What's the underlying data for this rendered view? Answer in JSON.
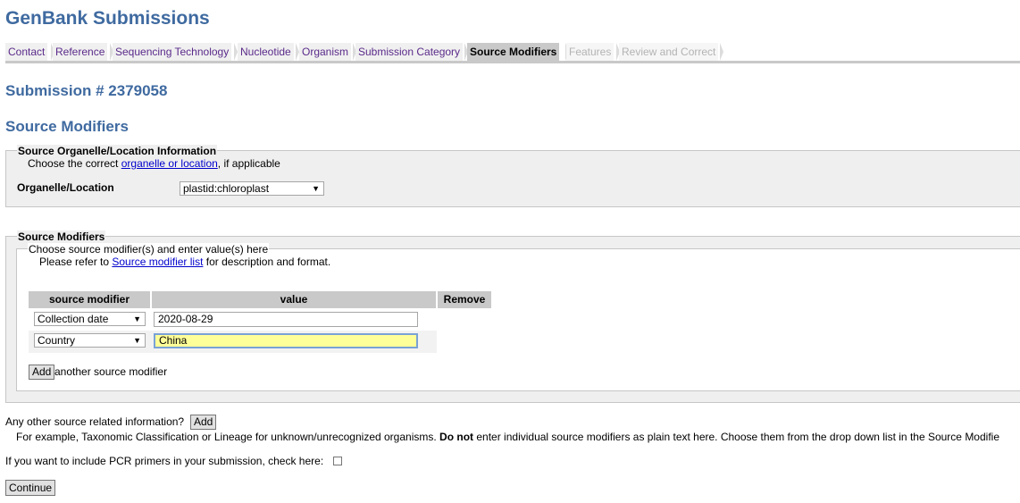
{
  "app_title": "GenBank Submissions",
  "tabs": [
    {
      "label": "Contact",
      "state": "normal"
    },
    {
      "label": "Reference",
      "state": "normal"
    },
    {
      "label": "Sequencing Technology",
      "state": "normal"
    },
    {
      "label": "Nucleotide",
      "state": "normal"
    },
    {
      "label": "Organism",
      "state": "normal"
    },
    {
      "label": "Submission Category",
      "state": "normal"
    },
    {
      "label": "Source Modifiers",
      "state": "active"
    },
    {
      "label": "Features",
      "state": "disabled"
    },
    {
      "label": "Review and Correct",
      "state": "disabled"
    }
  ],
  "submission_title": "Submission # 2379058",
  "section_title": "Source Modifiers",
  "organelle_box": {
    "legend": "Source Organelle/Location Information",
    "hint_prefix": "Choose the correct ",
    "hint_link": "organelle or location",
    "hint_suffix": ", if applicable",
    "field_label": "Organelle/Location",
    "selected_value": "plastid:chloroplast"
  },
  "modifiers_box": {
    "legend": "Source Modifiers",
    "inner_legend": "Choose source modifier(s) and enter value(s) here",
    "hint_prefix": "Please refer to ",
    "hint_link": "Source modifier list",
    "hint_suffix": " for description and format.",
    "columns": [
      "source modifier",
      "value",
      "Remove"
    ],
    "rows": [
      {
        "modifier": "Collection date",
        "value": "2020-08-29"
      },
      {
        "modifier": "Country",
        "value": "China"
      }
    ],
    "add_button": "Add",
    "add_suffix": "another source modifier"
  },
  "other_info": {
    "question": "Any other source related information?",
    "add_button": "Add",
    "note_prefix": "For example, Taxonomic Classification or Lineage for unknown/unrecognized organisms. ",
    "note_bold": "Do not",
    "note_suffix": " enter individual source modifiers as plain text here. Choose them from the drop down list in the Source Modifie"
  },
  "pcr": {
    "label": "If you want to include PCR primers in your submission, check here:"
  },
  "continue_button": "Continue"
}
